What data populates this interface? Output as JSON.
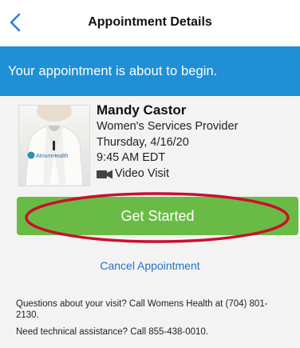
{
  "header": {
    "back_icon": "chevron-left-icon",
    "title": "Appointment Details"
  },
  "banner": {
    "message": "Your appointment is about to begin.",
    "color": "#1f8fd6"
  },
  "provider": {
    "photo_logo_text": "AtriumHealth",
    "name": "Mandy Castor",
    "role": "Women's Services Provider",
    "date": "Thursday, 4/16/20",
    "time": "9:45 AM EDT",
    "visit_icon": "video-camera-icon",
    "visit_type": "Video Visit"
  },
  "actions": {
    "get_started_label": "Get Started",
    "get_started_color": "#6abb45",
    "highlight_color": "#c8102e",
    "cancel_label": "Cancel Appointment"
  },
  "help": {
    "questions": "Questions about your visit? Call Womens Health at (704) 801-2130.",
    "technical": "Need technical assistance? Call 855-438-0010."
  }
}
